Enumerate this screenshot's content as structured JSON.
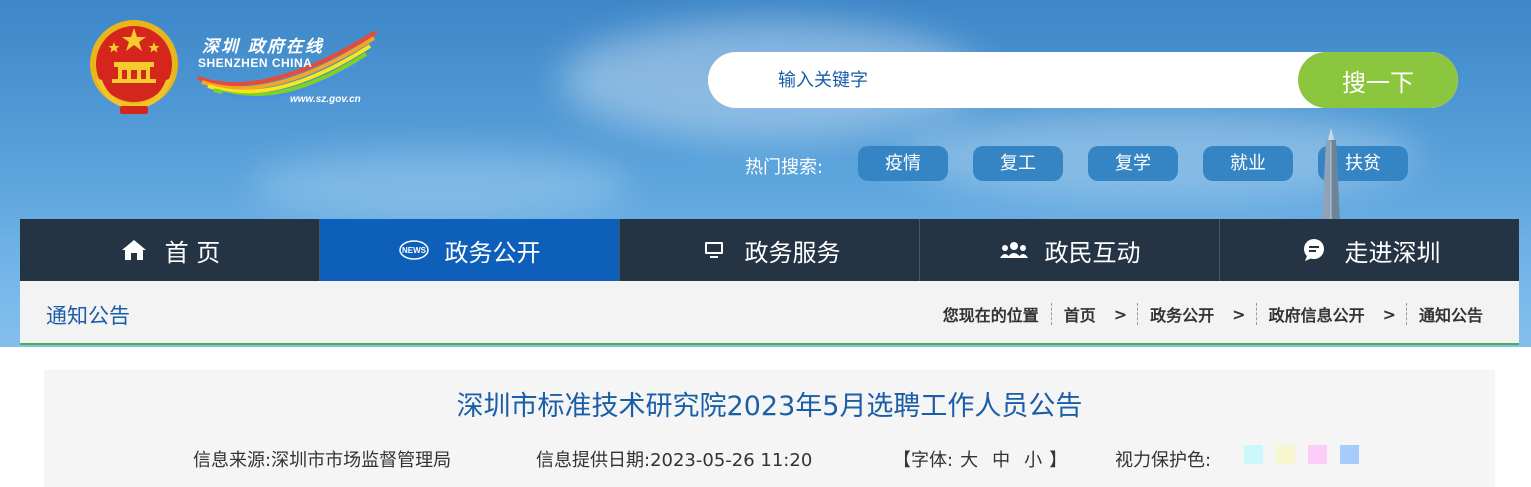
{
  "header": {
    "logo": {
      "cn_text": "深圳 政府在线",
      "en_text": "SHENZHEN CHINA",
      "url": "www.sz.gov.cn"
    },
    "emblem_icon": "national-emblem-icon"
  },
  "search": {
    "placeholder": "输入关键字",
    "button_label": "搜一下",
    "accent": "#8cc63e"
  },
  "hot_search": {
    "label": "热门搜索:",
    "tags": [
      "疫情",
      "复工",
      "复学",
      "就业",
      "扶贫"
    ]
  },
  "nav": {
    "items": [
      {
        "label": "首 页",
        "icon": "home-icon"
      },
      {
        "label": "政务公开",
        "icon": "news-icon"
      },
      {
        "label": "政务服务",
        "icon": "monitor-icon"
      },
      {
        "label": "政民互动",
        "icon": "users-icon"
      },
      {
        "label": "走进深圳",
        "icon": "chat-bubble-icon"
      }
    ],
    "active_index": 1,
    "active_color": "#0d5fb9"
  },
  "breadcrumb": {
    "section_title": "通知公告",
    "prefix": "您现在的位置",
    "items": [
      "首页",
      "政务公开",
      "政府信息公开",
      "通知公告"
    ],
    "separator": ">"
  },
  "article": {
    "title": "深圳市标准技术研究院2023年5月选聘工作人员公告",
    "source_label": "信息来源:深圳市市场监督管理局",
    "date_label": "信息提供日期:2023-05-26 11:20",
    "font_label_open": "【字体:",
    "font_options": [
      "大",
      "中",
      "小"
    ],
    "font_label_close": "】",
    "eye_care_label": "视力保护色:",
    "eye_care_colors": [
      "#ccf8fb",
      "#f6f7cd",
      "#fbcdf7",
      "#a6cdfa"
    ]
  }
}
